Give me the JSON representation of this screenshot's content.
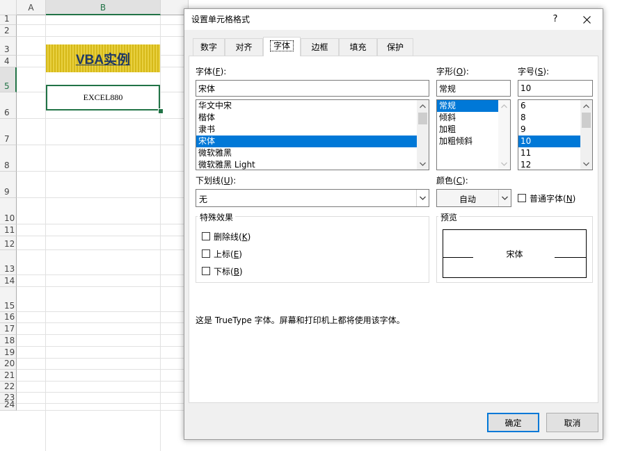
{
  "sheet": {
    "columns": [
      "A",
      "B"
    ],
    "rows": [
      "1",
      "2",
      "3",
      "4",
      "5",
      "6",
      "7",
      "8",
      "9",
      "10",
      "11",
      "12",
      "13",
      "14",
      "15",
      "16",
      "17",
      "18",
      "19",
      "20",
      "21",
      "22",
      "23",
      "24"
    ],
    "cell_b3": "VBA实例",
    "cell_b5": "EXCEL880",
    "colors": {
      "selection": "#217346",
      "b3_fill": "#d6b919",
      "b3_text": "#1f3864"
    }
  },
  "dialog": {
    "title": "设置单元格格式",
    "help_label": "?",
    "tabs": [
      "数字",
      "对齐",
      "字体",
      "边框",
      "填充",
      "保护"
    ],
    "active_tab": "字体",
    "font": {
      "label": "字体(",
      "accel": "F",
      "label_end": "):",
      "value": "宋体",
      "items": [
        "华文中宋",
        "楷体",
        "隶书",
        "宋体",
        "微软雅黑",
        "微软雅黑 Light"
      ],
      "selected": "宋体"
    },
    "style": {
      "label": "字形(",
      "accel": "O",
      "label_end": "):",
      "value": "常规",
      "items": [
        "常规",
        "倾斜",
        "加粗",
        "加粗倾斜"
      ],
      "selected": "常规"
    },
    "size": {
      "label": "字号(",
      "accel": "S",
      "label_end": "):",
      "value": "10",
      "items": [
        "6",
        "8",
        "9",
        "10",
        "11",
        "12"
      ],
      "selected": "10"
    },
    "underline": {
      "label": "下划线(",
      "accel": "U",
      "label_end": "):",
      "value": "无"
    },
    "color": {
      "label": "颜色(",
      "accel": "C",
      "label_end": "):",
      "value": "自动"
    },
    "normal_font": {
      "label": "普通字体(",
      "accel": "N",
      "label_end": ")",
      "checked": false
    },
    "effects": {
      "title": "特殊效果",
      "strikethrough": {
        "label": "删除线(",
        "accel": "K",
        "label_end": ")",
        "checked": false
      },
      "superscript": {
        "label": "上标(",
        "accel": "E",
        "label_end": ")",
        "checked": false
      },
      "subscript": {
        "label": "下标(",
        "accel": "B",
        "label_end": ")",
        "checked": false
      }
    },
    "preview": {
      "title": "预览",
      "sample": "宋体"
    },
    "info": "这是 TrueType 字体。屏幕和打印机上都将使用该字体。",
    "ok_label": "确定",
    "cancel_label": "取消",
    "colors": {
      "selection": "#0078d7",
      "ok_border": "#0078d7"
    }
  }
}
